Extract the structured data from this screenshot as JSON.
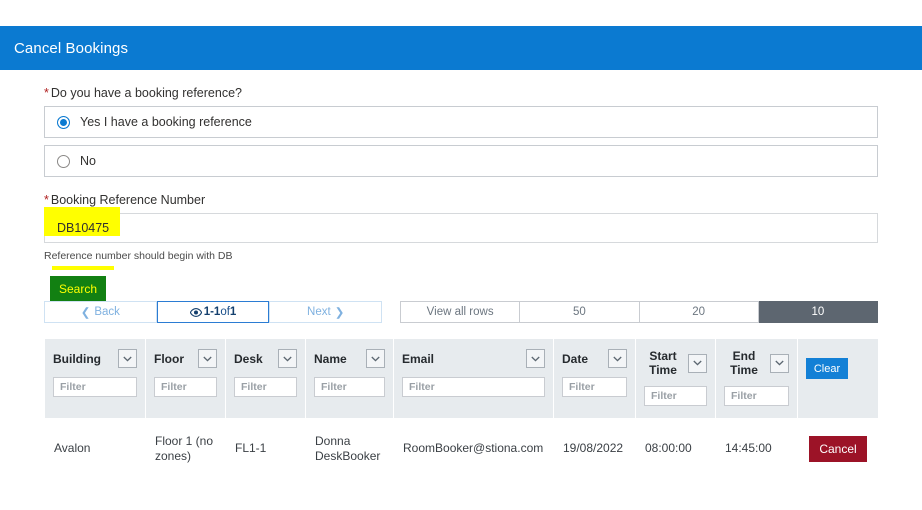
{
  "window": {
    "title": "Cancel Bookings",
    "header_color": "#0b7ad1"
  },
  "form": {
    "required_marker": "*",
    "question_label": "Do you have a booking reference?",
    "options": [
      {
        "label": "Yes I have a booking reference",
        "selected": true
      },
      {
        "label": "No",
        "selected": false
      }
    ],
    "reference_label": "Booking Reference Number",
    "reference_value": "DB10475",
    "reference_placeholder": "",
    "reference_hint": "Reference number should begin with DB",
    "search_button": "Search",
    "highlight_color": "#ffff00"
  },
  "pagination": {
    "back_label": "Back",
    "back_icon": "chevron-left-icon",
    "range_prefix": "1-1",
    "range_middle": " of ",
    "range_suffix": "1",
    "view_icon": "eye-icon",
    "next_label": "Next",
    "next_icon": "chevron-right-icon",
    "view_all_label": "View all rows",
    "page_sizes": [
      {
        "label": "50",
        "active": false
      },
      {
        "label": "20",
        "active": false
      },
      {
        "label": "10",
        "active": true
      }
    ],
    "active_color": "#5d6670"
  },
  "table": {
    "filter_placeholder": "Filter",
    "clear_label": "Clear",
    "clear_color": "#1380d6",
    "columns": [
      {
        "label": "Building",
        "has_dropdown": true,
        "has_filter": true
      },
      {
        "label": "Floor",
        "has_dropdown": true,
        "has_filter": true
      },
      {
        "label": "Desk",
        "has_dropdown": true,
        "has_filter": true
      },
      {
        "label": "Name",
        "has_dropdown": true,
        "has_filter": true
      },
      {
        "label": "Email",
        "has_dropdown": true,
        "has_filter": true
      },
      {
        "label": "Date",
        "has_dropdown": true,
        "has_filter": true
      },
      {
        "label": "Start Time",
        "has_dropdown": true,
        "has_filter": true
      },
      {
        "label": "End Time",
        "has_dropdown": true,
        "has_filter": true
      },
      {
        "label": "",
        "has_dropdown": false,
        "has_filter": false
      }
    ],
    "rows": [
      {
        "building": "Avalon",
        "floor": "Floor 1 (no zones)",
        "desk": "FL1-1",
        "name": "Donna DeskBooker",
        "email": "RoomBooker@stiona.com",
        "date": "19/08/2022",
        "start_time": "08:00:00",
        "end_time": "14:45:00",
        "action_label": "Cancel",
        "action_color": "#9c1327"
      }
    ]
  }
}
